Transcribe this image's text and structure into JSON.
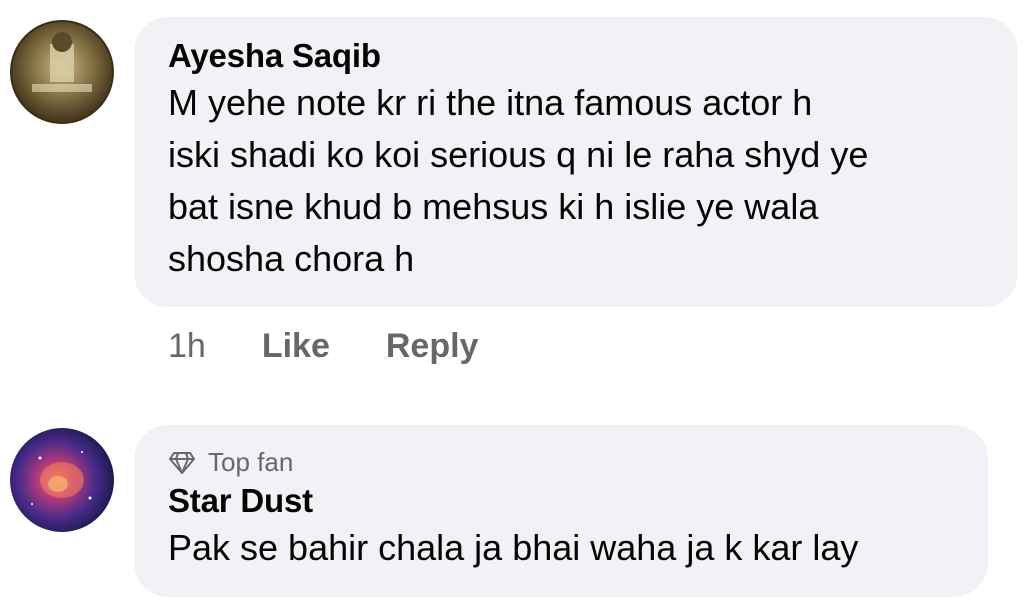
{
  "comments": [
    {
      "author": "Ayesha Saqib",
      "lines": [
        "M yehe note kr ri the itna famous actor h",
        "iski shadi ko koi serious q ni le raha shyd ye",
        "bat isne khud b mehsus ki h islie ye wala",
        "shosha chora h"
      ],
      "time": "1h",
      "like_label": "Like",
      "reply_label": "Reply"
    },
    {
      "badge": "Top fan",
      "author": "Star Dust",
      "lines": [
        "Pak se bahir chala ja bhai waha ja k kar lay"
      ]
    }
  ],
  "colors": {
    "bubble": "#f0f2f5",
    "text": "#050505",
    "secondary": "#65676b"
  }
}
